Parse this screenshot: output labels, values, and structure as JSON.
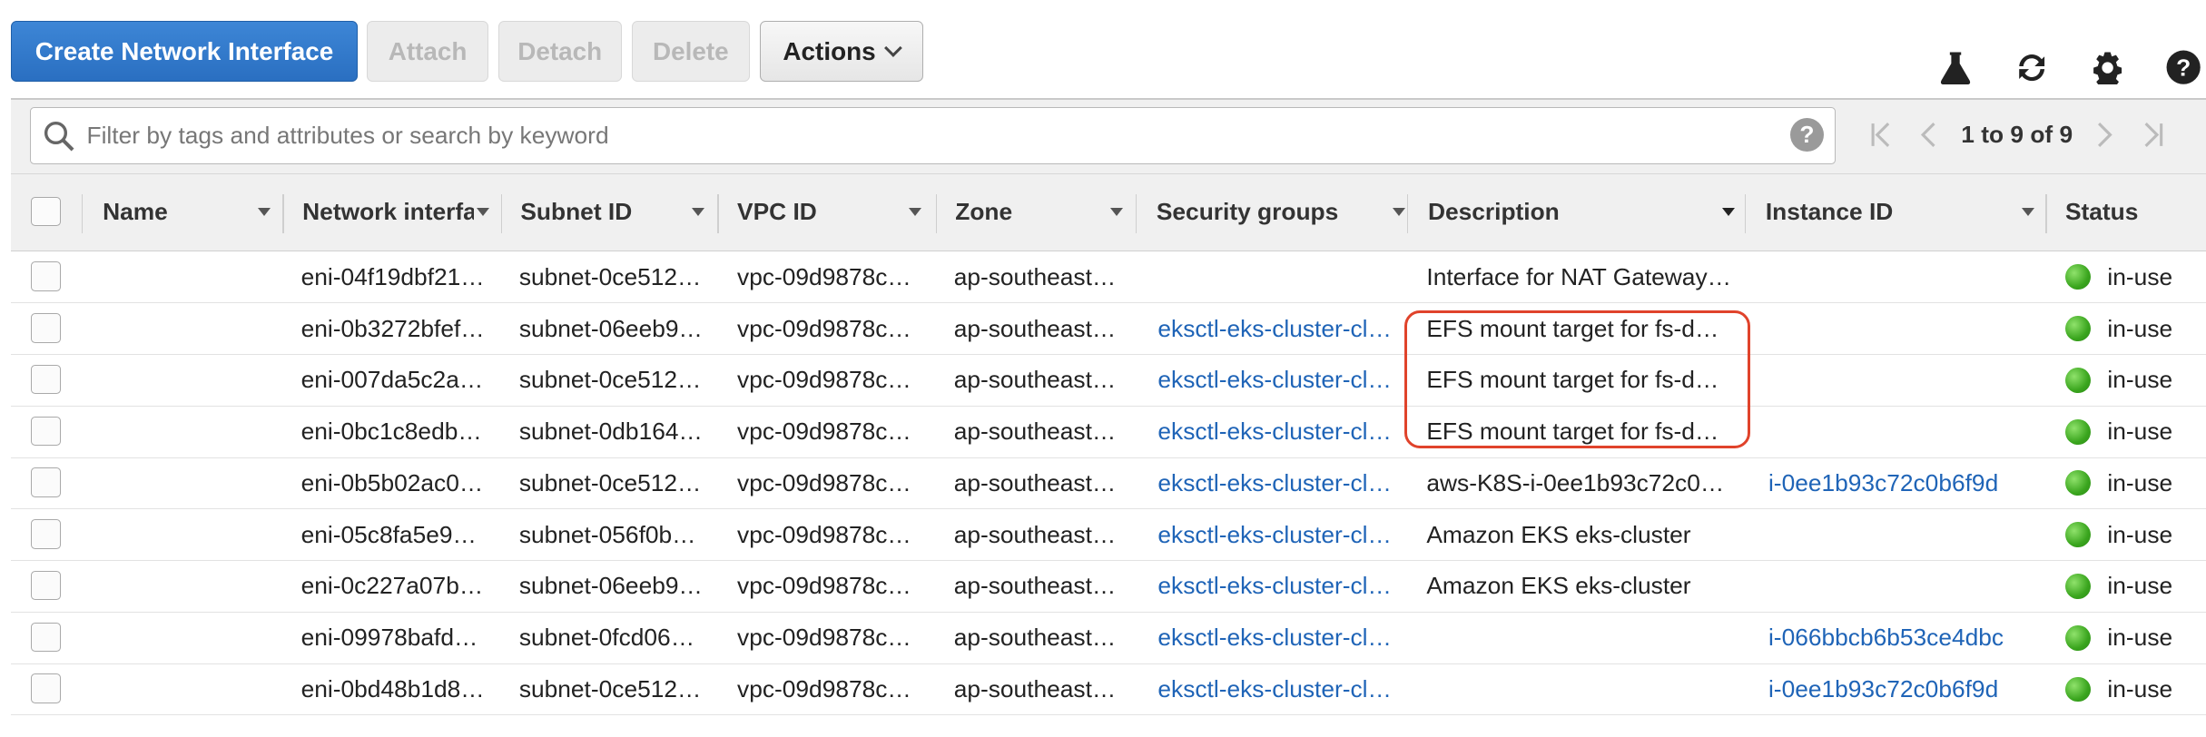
{
  "toolbar": {
    "create_label": "Create Network Interface",
    "attach_label": "Attach",
    "detach_label": "Detach",
    "delete_label": "Delete",
    "actions_label": "Actions"
  },
  "icons": [
    "flask-icon",
    "refresh-icon",
    "gear-icon",
    "help-icon"
  ],
  "filter": {
    "placeholder": "Filter by tags and attributes or search by keyword",
    "help_glyph": "?"
  },
  "pagination": {
    "text": "1 to 9 of 9"
  },
  "columns": [
    "Name",
    "Network interfa",
    "Subnet ID",
    "VPC ID",
    "Zone",
    "Security groups",
    "Description",
    "Instance ID",
    "Status"
  ],
  "rows": [
    {
      "name": "",
      "eni": "eni-04f19dbf21…",
      "subnet": "subnet-0ce512…",
      "vpc": "vpc-09d9878c…",
      "zone": "ap-southeast…",
      "sg": "",
      "desc": "Interface for NAT Gateway…",
      "instance": "",
      "status": "in-use"
    },
    {
      "name": "",
      "eni": "eni-0b3272bfef…",
      "subnet": "subnet-06eeb9…",
      "vpc": "vpc-09d9878c…",
      "zone": "ap-southeast…",
      "sg": "eksctl-eks-cluster-cl…",
      "desc": "EFS mount target for fs-d…",
      "instance": "",
      "status": "in-use"
    },
    {
      "name": "",
      "eni": "eni-007da5c2a…",
      "subnet": "subnet-0ce512…",
      "vpc": "vpc-09d9878c…",
      "zone": "ap-southeast…",
      "sg": "eksctl-eks-cluster-cl…",
      "desc": "EFS mount target for fs-d…",
      "instance": "",
      "status": "in-use"
    },
    {
      "name": "",
      "eni": "eni-0bc1c8edb…",
      "subnet": "subnet-0db164…",
      "vpc": "vpc-09d9878c…",
      "zone": "ap-southeast…",
      "sg": "eksctl-eks-cluster-cl…",
      "desc": "EFS mount target for fs-d…",
      "instance": "",
      "status": "in-use"
    },
    {
      "name": "",
      "eni": "eni-0b5b02ac0…",
      "subnet": "subnet-0ce512…",
      "vpc": "vpc-09d9878c…",
      "zone": "ap-southeast…",
      "sg": "eksctl-eks-cluster-cl…",
      "desc": "aws-K8S-i-0ee1b93c72c0…",
      "instance": "i-0ee1b93c72c0b6f9d",
      "status": "in-use"
    },
    {
      "name": "",
      "eni": "eni-05c8fa5e9…",
      "subnet": "subnet-056f0b…",
      "vpc": "vpc-09d9878c…",
      "zone": "ap-southeast…",
      "sg": "eksctl-eks-cluster-cl…",
      "desc": "Amazon EKS eks-cluster",
      "instance": "",
      "status": "in-use"
    },
    {
      "name": "",
      "eni": "eni-0c227a07b…",
      "subnet": "subnet-06eeb9…",
      "vpc": "vpc-09d9878c…",
      "zone": "ap-southeast…",
      "sg": "eksctl-eks-cluster-cl…",
      "desc": "Amazon EKS eks-cluster",
      "instance": "",
      "status": "in-use"
    },
    {
      "name": "",
      "eni": "eni-09978bafd…",
      "subnet": "subnet-0fcd06…",
      "vpc": "vpc-09d9878c…",
      "zone": "ap-southeast…",
      "sg": "eksctl-eks-cluster-cl…",
      "desc": "",
      "instance": "i-066bbcb6b53ce4dbc",
      "status": "in-use"
    },
    {
      "name": "",
      "eni": "eni-0bd48b1d8…",
      "subnet": "subnet-0ce512…",
      "vpc": "vpc-09d9878c…",
      "zone": "ap-southeast…",
      "sg": "eksctl-eks-cluster-cl…",
      "desc": "",
      "instance": "i-0ee1b93c72c0b6f9d",
      "status": "in-use"
    }
  ],
  "colors": {
    "primary": "#2a6fc1",
    "link": "#1f64b7",
    "highlight": "#e0432b",
    "status_ok": "#3aa51e"
  }
}
